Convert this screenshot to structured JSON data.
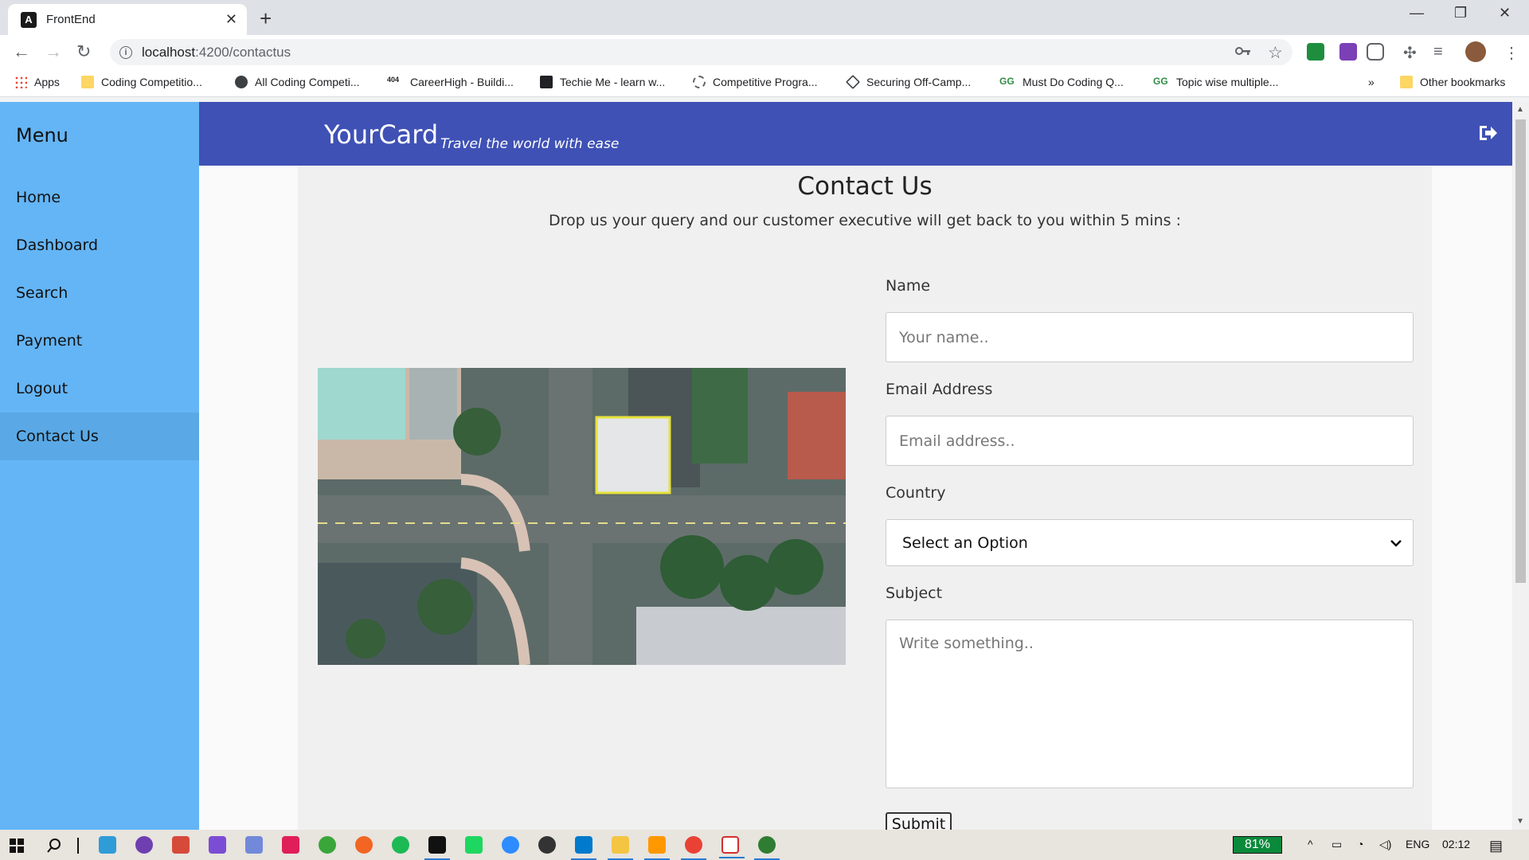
{
  "browser": {
    "tab_title": "FrontEnd",
    "tab_close": "✕",
    "new_tab": "+",
    "url_host": "localhost",
    "url_path": ":4200/contactus",
    "bookmarks": [
      {
        "label": "Apps",
        "color": "#ea4335"
      },
      {
        "label": "Coding Competitio...",
        "color": "#fdd663"
      },
      {
        "label": "All Coding Competi...",
        "color": "#3c4043"
      },
      {
        "label": "CareerHigh - Buildi...",
        "color": "#202124"
      },
      {
        "label": "Techie Me - learn w...",
        "color": "#202124"
      },
      {
        "label": "Competitive Progra...",
        "color": "#5f6368"
      },
      {
        "label": "Securing Off-Camp...",
        "color": "#3c4043"
      },
      {
        "label": "Must Do Coding Q...",
        "color": "#2f8d46"
      },
      {
        "label": "Topic wise multiple...",
        "color": "#2f8d46"
      }
    ],
    "bookmarks_overflow": "»",
    "other_bookmarks": "Other bookmarks"
  },
  "sidebar": {
    "title": "Menu",
    "items": [
      {
        "label": "Home"
      },
      {
        "label": "Dashboard"
      },
      {
        "label": "Search"
      },
      {
        "label": "Payment"
      },
      {
        "label": "Logout"
      },
      {
        "label": "Contact Us",
        "active": true
      }
    ]
  },
  "header": {
    "brand": "YourCard",
    "tagline": "Travel the world with ease"
  },
  "main": {
    "title": "Contact Us",
    "subtitle": "Drop us your query and our customer executive will get back to you within 5 mins :",
    "form": {
      "name_label": "Name",
      "name_placeholder": "Your name..",
      "email_label": "Email Address",
      "email_placeholder": "Email address..",
      "country_label": "Country",
      "country_selected": "Select an Option",
      "subject_label": "Subject",
      "subject_placeholder": "Write something..",
      "submit_label": "Submit"
    }
  },
  "taskbar": {
    "battery": "81%",
    "language": "ENG",
    "time": "02:12"
  },
  "colors": {
    "sidebar": "#64b5f6",
    "appbar": "#3f51b5"
  }
}
